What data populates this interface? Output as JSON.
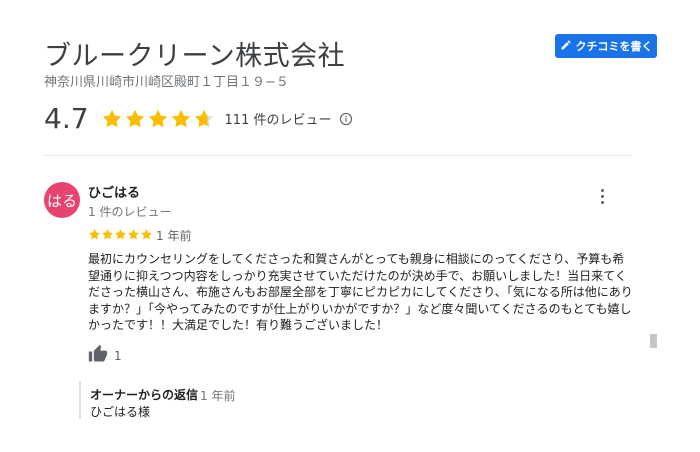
{
  "business": {
    "name": "ブルークリーン株式会社",
    "address": "神奈川県川崎市川崎区殿町１丁目１９−５",
    "rating": "4.7",
    "rating_value": 4.7,
    "review_count": "111 件のレビュー"
  },
  "actions": {
    "write_review": "クチコミを書く"
  },
  "review": {
    "avatar_text": "はる",
    "avatar_color": "#e8436e",
    "reviewer_name": "ひごはる",
    "reviewer_reviews": "1 件のレビュー",
    "stars": 5,
    "time": "1 年前",
    "text": "最初にカウンセリングをしてくださった和賀さんがとっても親身に相談にのってくださり、予算も希望通りに抑えつつ内容をしっかり充実させていただけたのが決め手で、お願いしました！当日来てくださった横山さん、布施さんもお部屋全部を丁寧にピカピカにしてくださり、「気になる所は他にありますか？」「今やってみたのですが仕上がりいかがですか？」など度々聞いてくださるのもとても嬉しかったです！！大満足でした！有り難うございました！",
    "likes": "1"
  },
  "owner_reply": {
    "title": "オーナーからの返信",
    "time": "1 年前",
    "text": "ひごはる様"
  },
  "colors": {
    "star": "#fbbc04",
    "accent": "#1a73e8"
  },
  "icons": {
    "write": "pencil-icon",
    "info": "info-icon",
    "more": "more-vert-icon",
    "like": "thumb-up-icon"
  }
}
